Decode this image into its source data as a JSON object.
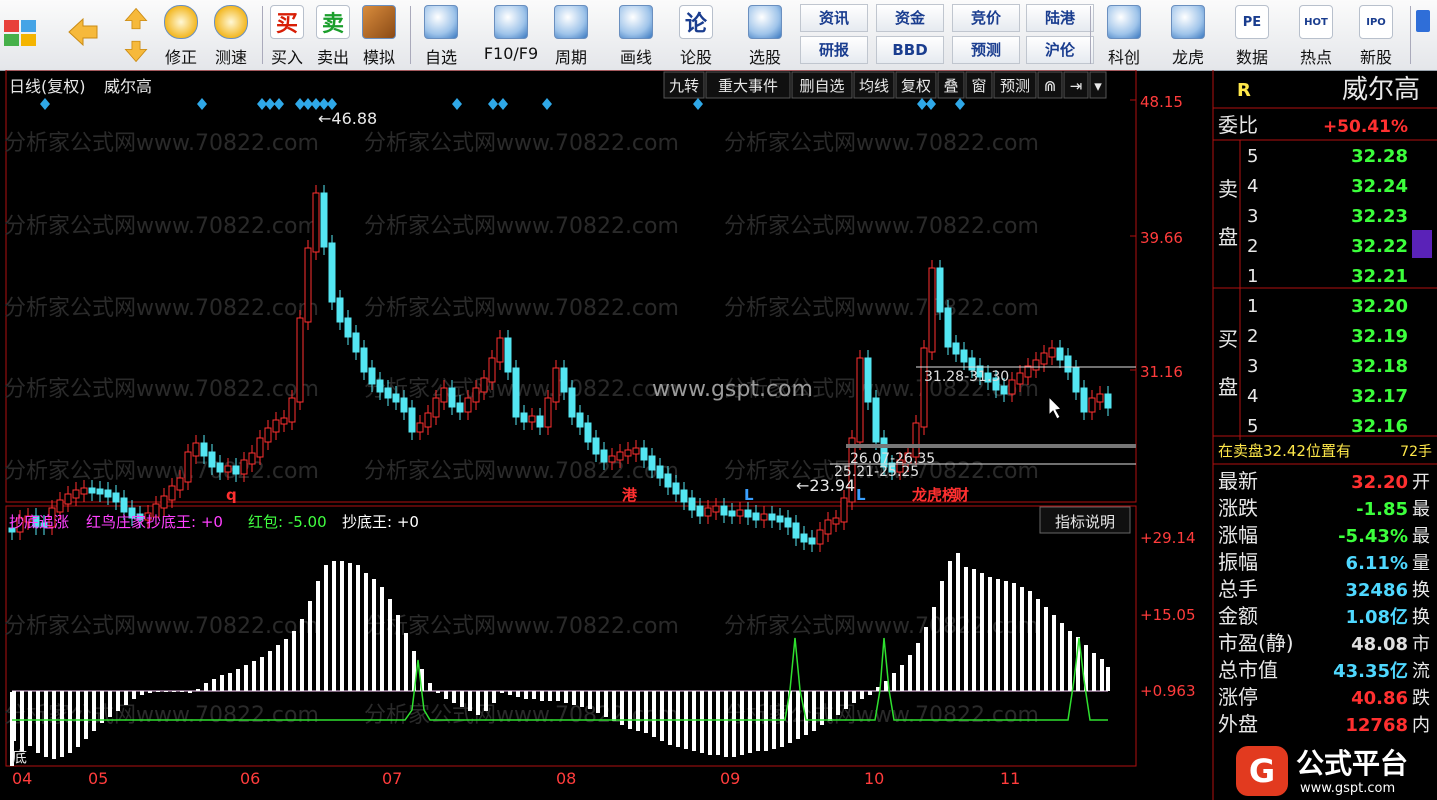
{
  "toolbar": {
    "buttons": [
      {
        "id": "fwd",
        "label": "修正",
        "icon": "refresh-icon"
      },
      {
        "id": "ce",
        "label": "测速",
        "icon": "clock-icon"
      },
      {
        "id": "buy",
        "label": "买入",
        "icon": "buy-icon",
        "glyph": "买",
        "color": "#d81e06"
      },
      {
        "id": "sell",
        "label": "卖出",
        "icon": "sell-icon",
        "glyph": "卖",
        "color": "#1a9e2b"
      },
      {
        "id": "sim",
        "label": "模拟",
        "icon": "hammer-icon"
      },
      {
        "id": "zx",
        "label": "自选",
        "icon": "star-folder-icon"
      },
      {
        "id": "f10",
        "label": "F10/F9",
        "icon": "document-icon"
      },
      {
        "id": "zq",
        "label": "周期",
        "icon": "period-icon"
      },
      {
        "id": "hx",
        "label": "画线",
        "icon": "pencil-icon"
      },
      {
        "id": "lg",
        "label": "论股",
        "icon": "discuss-icon",
        "glyph": "论"
      },
      {
        "id": "xg",
        "label": "选股",
        "icon": "select-stock-icon"
      },
      {
        "id": "kc",
        "label": "科创",
        "icon": "chart-line-icon"
      },
      {
        "id": "lh",
        "label": "龙虎",
        "icon": "dragon-icon"
      },
      {
        "id": "sj",
        "label": "数据",
        "icon": "pe-icon",
        "glyph": "PE"
      },
      {
        "id": "rd",
        "label": "热点",
        "icon": "hot-icon",
        "glyph": "HOT"
      },
      {
        "id": "xgu",
        "label": "新股",
        "icon": "ipo-icon",
        "glyph": "IPO"
      }
    ],
    "small_buttons": [
      "资讯",
      "资金",
      "竞价",
      "陆港",
      "研报",
      "BBD",
      "预测",
      "沪伦"
    ]
  },
  "main_panel": {
    "title": "日线(复权)",
    "stock_name": "威尔高",
    "top_buttons": [
      "九转",
      "重大事件",
      "删自选",
      "均线",
      "复权",
      "叠",
      "窗",
      "预测",
      "⋒",
      "⇥",
      "▾"
    ],
    "price_axis": [
      "48.15",
      "39.66",
      "31.16"
    ],
    "price_high_label": "46.88",
    "price_low_label": "23.94",
    "range_labels": [
      "31.28-31.30",
      "26.07-26.35",
      "25.21-25.25"
    ],
    "event_markers": [
      {
        "text": "q",
        "color": "#ff3030"
      },
      {
        "text": "港",
        "color": "#ff3030"
      },
      {
        "text": "L",
        "color": "#3aa0ff"
      },
      {
        "text": "L",
        "color": "#3aa0ff"
      },
      {
        "text": "龙虎榜",
        "color": "#ff3030"
      },
      {
        "text": "财",
        "color": "#ff3030"
      }
    ],
    "watermark": "分析家公式网www.70822.com",
    "center_watermark": "www.gspt.com"
  },
  "indicator_panel": {
    "name": "抄底追涨",
    "items": [
      {
        "text": "红鸟庄家抄底王: +0",
        "color": "#ff40ff"
      },
      {
        "text": "红包: -5.00",
        "color": "#40ff40"
      },
      {
        "text": "抄底王: +0",
        "color": "#ffffff"
      }
    ],
    "help_button": "指标说明",
    "axis": [
      "+29.14",
      "+15.05",
      "+0.963"
    ],
    "bottom_label": "底"
  },
  "date_axis": [
    "04",
    "05",
    "06",
    "07",
    "08",
    "09",
    "10",
    "11"
  ],
  "quote": {
    "code_flag": "R",
    "name": "威尔高",
    "weibi_label": "委比",
    "weibi_value": "+50.41%",
    "sell_label_1": "卖",
    "sell_label_2": "盘",
    "buy_label_1": "买",
    "buy_label_2": "盘",
    "asks": [
      {
        "level": "5",
        "price": "32.28"
      },
      {
        "level": "4",
        "price": "32.24"
      },
      {
        "level": "3",
        "price": "32.23"
      },
      {
        "level": "2",
        "price": "32.22"
      },
      {
        "level": "1",
        "price": "32.21"
      }
    ],
    "bids": [
      {
        "level": "1",
        "price": "32.20"
      },
      {
        "level": "2",
        "price": "32.19"
      },
      {
        "level": "3",
        "price": "32.18"
      },
      {
        "level": "4",
        "price": "32.17"
      },
      {
        "level": "5",
        "price": "32.16"
      }
    ],
    "notice": "在卖盘32.42位置有",
    "notice_value": "72手",
    "stats": [
      {
        "label": "最新",
        "value": "32.20",
        "color": "#ff3030",
        "right": "开"
      },
      {
        "label": "涨跌",
        "value": "-1.85",
        "color": "#3cff3c",
        "right": "最"
      },
      {
        "label": "涨幅",
        "value": "-5.43%",
        "color": "#3cff3c",
        "right": "最"
      },
      {
        "label": "振幅",
        "value": "6.11%",
        "color": "#4fd8ff",
        "right": "量"
      },
      {
        "label": "总手",
        "value": "32486",
        "color": "#4fd8ff",
        "right": "换"
      },
      {
        "label": "金额",
        "value": "1.08亿",
        "color": "#4fd8ff",
        "right": "换"
      },
      {
        "label": "市盈(静)",
        "value": "48.08",
        "color": "#e0e0e0",
        "right": "市"
      },
      {
        "label": "总市值",
        "value": "43.35亿",
        "color": "#4fd8ff",
        "right": "流"
      },
      {
        "label": "涨停",
        "value": "40.86",
        "color": "#ff3030",
        "right": "跌"
      },
      {
        "label": "外盘",
        "value": "12768",
        "color": "#ff3030",
        "right": "内"
      }
    ]
  },
  "logo": {
    "text": "公式平台",
    "url": "www.gspt.com"
  }
}
